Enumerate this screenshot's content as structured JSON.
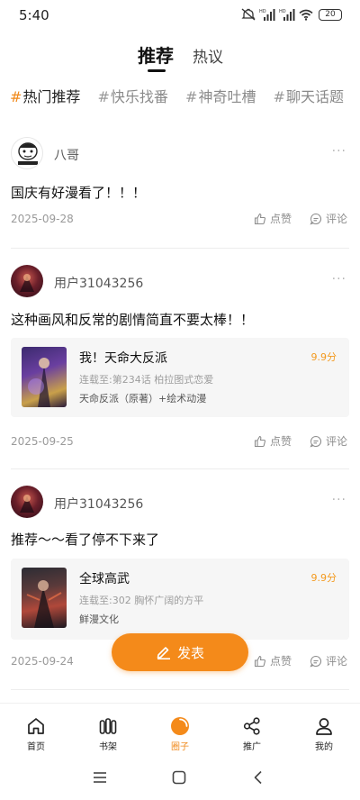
{
  "status_bar": {
    "time": "5:40",
    "battery": "20"
  },
  "top_tabs": {
    "main": "推荐",
    "second": "热议"
  },
  "topics": [
    {
      "label": "热门推荐",
      "active": true
    },
    {
      "label": "快乐找番",
      "active": false
    },
    {
      "label": "神奇吐槽",
      "active": false
    },
    {
      "label": "聊天话题",
      "active": false
    }
  ],
  "posts": [
    {
      "username": "八哥",
      "text": "国庆有好漫看了！！！",
      "date": "2025-09-28",
      "like_label": "点赞",
      "comment_label": "评论"
    },
    {
      "username": "用户31043256",
      "text": "这种画风和反常的剧情简直不要太棒！！",
      "date": "2025-09-25",
      "like_label": "点赞",
      "comment_label": "评论",
      "book": {
        "title": "我！天命大反派",
        "score": "9.9分",
        "update": "连载至:第234话 柏拉图式恋爱",
        "tags": "天命反派（原著）+绘术动漫"
      }
    },
    {
      "username": "用户31043256",
      "text": "推荐～～看了停不下来了",
      "date": "2025-09-24",
      "like_label": "点赞",
      "comment_label": "评论",
      "book": {
        "title": "全球高武",
        "score": "9.9分",
        "update": "连载至:302 胸怀广阔的方平",
        "tags": "鲜漫文化"
      }
    }
  ],
  "more_glyph": "···",
  "fab_label": "发表",
  "bottom_nav": [
    {
      "label": "首页",
      "icon": "home-icon",
      "active": false
    },
    {
      "label": "书架",
      "icon": "bookshelf-icon",
      "active": false
    },
    {
      "label": "圈子",
      "icon": "circle-icon",
      "active": true
    },
    {
      "label": "推广",
      "icon": "share-icon",
      "active": false
    },
    {
      "label": "我的",
      "icon": "profile-icon",
      "active": false
    }
  ],
  "colors": {
    "accent": "#f48a1a",
    "score": "#f39a1f"
  }
}
